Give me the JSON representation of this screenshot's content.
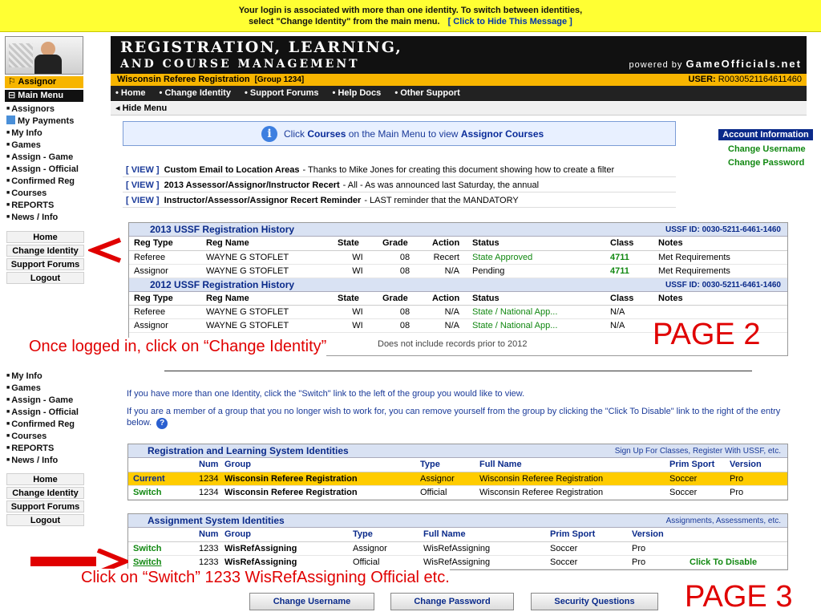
{
  "banner": {
    "line1": "Your login is associated with more than one identity. To switch between identities,",
    "line2": "select \"Change Identity\" from the main menu.",
    "hide_link": "[ Click to Hide This Message ]"
  },
  "sidebar": {
    "role": "Assignor",
    "main_menu": "Main Menu",
    "items_top": [
      "Assignors",
      "My Payments",
      "My Info",
      "Games",
      "Assign - Game",
      "Assign - Official",
      "Confirmed Reg",
      "Courses",
      "REPORTS",
      "News / Info"
    ],
    "buttons_top": [
      "Home",
      "Change Identity",
      "Support Forums",
      "Logout"
    ],
    "items_bottom": [
      "My Info",
      "Games",
      "Assign - Game",
      "Assign - Official",
      "Confirmed Reg",
      "Courses",
      "REPORTS",
      "News / Info"
    ],
    "buttons_bottom": [
      "Home",
      "Change Identity",
      "Support Forums",
      "Logout"
    ]
  },
  "header": {
    "title1": "REGISTRATION, LEARNING,",
    "title2": "AND COURSE MANAGEMENT",
    "powered_prefix": "powered by",
    "powered_brand": "GameOfficials.net",
    "org": "Wisconsin Referee Registration",
    "group": "[Group 1234]",
    "user_label": "USER:",
    "user_id": "R0030521164611460",
    "nav": [
      "• Home",
      "• Change Identity",
      "• Support Forums",
      "• Help Docs",
      "• Other Support"
    ],
    "hide_menu": "◂ Hide Menu"
  },
  "info": {
    "pre": "Click",
    "courses": "Courses",
    "mid": "on the Main Menu to view",
    "assignor": "Assignor Courses"
  },
  "account": {
    "header": "Account Information",
    "links": [
      "Change Username",
      "Change Password"
    ]
  },
  "news": [
    {
      "view": "[ VIEW ]",
      "title": "Custom Email to Location Areas",
      "text": "- Thanks to Mike Jones for creating this document showing how to create a filter"
    },
    {
      "view": "[ VIEW ]",
      "title": "2013 Assessor/Assignor/Instructor Recert",
      "text": "- All - As was announced last Saturday, the annual"
    },
    {
      "view": "[ VIEW ]",
      "title": "Instructor/Assessor/Assignor Recert Reminder",
      "text": "- LAST reminder that the MANDATORY"
    }
  ],
  "hist2013": {
    "title": "2013 USSF Registration History",
    "ussf_id": "USSF ID: 0030-5211-6461-1460",
    "headers": [
      "Reg Type",
      "Reg Name",
      "State",
      "Grade",
      "Action",
      "Status",
      "Class",
      "Notes"
    ],
    "rows": [
      [
        "Referee",
        "WAYNE G STOFLET",
        "WI",
        "08",
        "Recert",
        "State Approved",
        "4711",
        "Met Requirements"
      ],
      [
        "Assignor",
        "WAYNE G STOFLET",
        "WI",
        "08",
        "N/A",
        "Pending",
        "4711",
        "Met Requirements"
      ]
    ]
  },
  "hist2012": {
    "title": "2012 USSF Registration History",
    "ussf_id": "USSF ID: 0030-5211-6461-1460",
    "headers": [
      "Reg Type",
      "Reg Name",
      "State",
      "Grade",
      "Action",
      "Status",
      "Class",
      "Notes"
    ],
    "rows": [
      [
        "Referee",
        "WAYNE G STOFLET",
        "WI",
        "08",
        "N/A",
        "State / National App...",
        "N/A",
        ""
      ],
      [
        "Assignor",
        "WAYNE G STOFLET",
        "WI",
        "08",
        "N/A",
        "State / National App...",
        "N/A",
        ""
      ]
    ],
    "footnote": "Does not include records prior to 2012"
  },
  "annotations": {
    "page2": "PAGE 2",
    "page3": "PAGE 3",
    "once": "Once logged in, click on “Change Identity”",
    "click_switch": "Click on “Switch”  1233 WisRefAssigning  Official etc."
  },
  "page3": {
    "p1": "If you have more than one Identity, click the \"Switch\" link to the left of the group you would like to view.",
    "p2": "If you are a member of a group that you no longer wish to work for, you can remove yourself from the group by clicking the \"Click To Disable\" link to the right of the entry below.",
    "reg_ident": {
      "title": "Registration and Learning System Identities",
      "right": "Sign Up For Classes, Register With USSF, etc.",
      "headers": [
        "",
        "Num",
        "Group",
        "Type",
        "Full Name",
        "Prim Sport",
        "Version"
      ],
      "rows": [
        [
          "Current",
          "1234",
          "Wisconsin Referee Registration",
          "Assignor",
          "Wisconsin Referee Registration",
          "Soccer",
          "Pro"
        ],
        [
          "Switch",
          "1234",
          "Wisconsin Referee Registration",
          "Official",
          "Wisconsin Referee Registration",
          "Soccer",
          "Pro"
        ]
      ]
    },
    "assign_ident": {
      "title": "Assignment System Identities",
      "right": "Assignments, Assessments, etc.",
      "headers": [
        "",
        "Num",
        "Group",
        "Type",
        "Full Name",
        "Prim Sport",
        "Version",
        ""
      ],
      "rows": [
        [
          "Switch",
          "1233",
          "WisRefAssigning",
          "Assignor",
          "WisRefAssigning",
          "Soccer",
          "Pro",
          ""
        ],
        [
          "Switch",
          "1233",
          "WisRefAssigning",
          "Official",
          "WisRefAssigning",
          "Soccer",
          "Pro",
          "Click To Disable"
        ]
      ]
    },
    "buttons": [
      "Change Username",
      "Change Password",
      "Security Questions"
    ]
  },
  "colors": {
    "banner": "#ffff33",
    "accent_yellow": "#f7b500",
    "nav_dark": "#111111",
    "annotation_red": "#e00000",
    "link_green": "#118811"
  }
}
